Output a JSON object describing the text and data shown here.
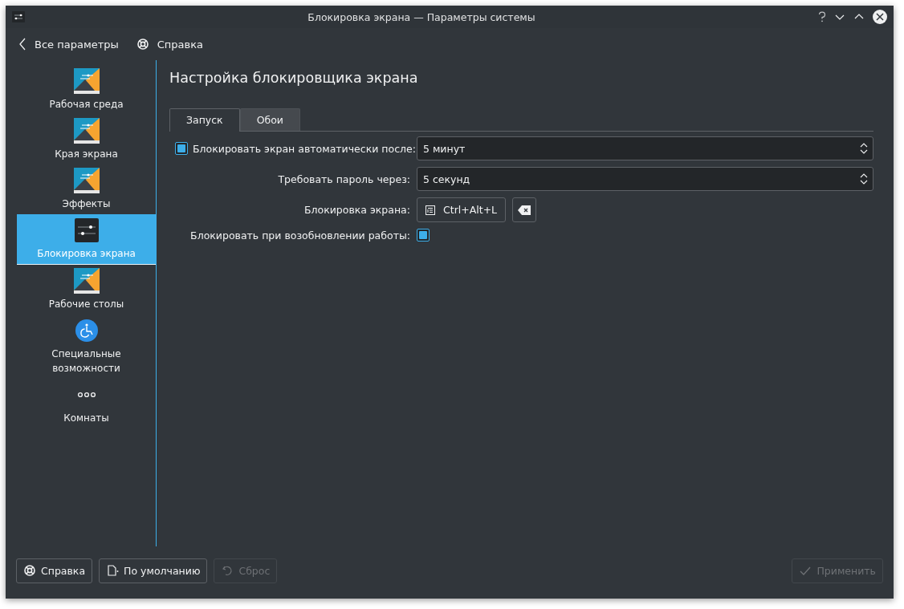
{
  "window": {
    "title": "Блокировка экрана — Параметры системы"
  },
  "toolbar": [
    {
      "label": "Все параметры",
      "kind": "back"
    },
    {
      "label": "Справка",
      "kind": "help"
    }
  ],
  "sidebar": {
    "items": [
      {
        "label": "Рабочая среда",
        "kind": "tile",
        "selected": false
      },
      {
        "label": "Края экрана",
        "kind": "tile",
        "selected": false
      },
      {
        "label": "Эффекты",
        "kind": "tile",
        "selected": false
      },
      {
        "label": "Блокировка экрана",
        "kind": "sliders",
        "selected": true
      },
      {
        "label": "Рабочие столы",
        "kind": "tile",
        "selected": false
      },
      {
        "label": "Специальные возможности",
        "kind": "accessibility",
        "selected": false
      },
      {
        "label": "Комнаты",
        "kind": "dots",
        "selected": false
      }
    ]
  },
  "page": {
    "title": "Настройка блокировщика экрана"
  },
  "tabs": [
    {
      "label": "Запуск",
      "selected": true
    },
    {
      "label": "Обои",
      "selected": false
    }
  ],
  "settings": [
    {
      "kind": "checkbox-spin",
      "label": "Блокировать экран автоматически после:",
      "checked": true,
      "value": "5 минут"
    },
    {
      "kind": "spin",
      "label": "Требовать пароль через:",
      "value": "5 секунд"
    },
    {
      "kind": "shortcut",
      "label": "Блокировка экрана:",
      "value": "Ctrl+Alt+L"
    },
    {
      "kind": "checkbox",
      "label": "Блокировать при возобновлении работы:",
      "checked": true
    }
  ],
  "buttons": [
    {
      "label": "Справка",
      "kind": "help",
      "disabled": false
    },
    {
      "label": "По умолчанию",
      "kind": "defaults",
      "disabled": false
    },
    {
      "label": "Сброс",
      "kind": "undo",
      "disabled": true
    },
    {
      "label": "Применить",
      "kind": "check",
      "disabled": true
    }
  ]
}
